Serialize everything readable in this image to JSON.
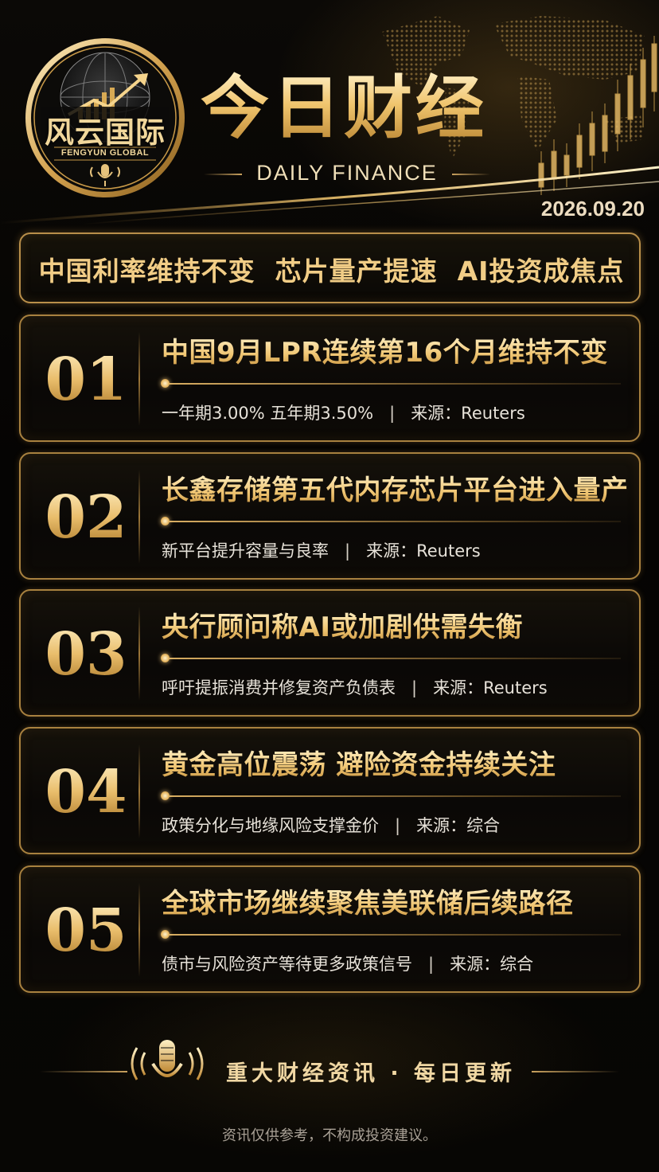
{
  "brand": {
    "logo_name": "风云国际",
    "logo_subtitle": "FENGYUN GLOBAL"
  },
  "header": {
    "title": "今日财经",
    "subtitle": "DAILY FINANCE",
    "date": "2026.09.20"
  },
  "headline": "中国利率维持不变  芯片量产提速  AI投资成焦点",
  "news": [
    {
      "num": "01",
      "title": "中国9月LPR连续第16个月维持不变",
      "detail": "一年期3.00% 五年期3.50%",
      "separator": "|",
      "source": "来源：Reuters"
    },
    {
      "num": "02",
      "title": "长鑫存储第五代内存芯片平台进入量产",
      "detail": "新平台提升容量与良率",
      "separator": "|",
      "source": "来源：Reuters"
    },
    {
      "num": "03",
      "title": "央行顾问称AI或加剧供需失衡",
      "detail": "呼吁提振消费并修复资产负债表",
      "separator": "|",
      "source": "来源：Reuters"
    },
    {
      "num": "04",
      "title": "黄金高位震荡  避险资金持续关注",
      "detail": "政策分化与地缘风险支撑金价",
      "separator": "|",
      "source": "来源：综合"
    },
    {
      "num": "05",
      "title": "全球市场继续聚焦美联储后续路径",
      "detail": "债市与风险资产等待更多政策信号",
      "separator": "|",
      "source": "来源：综合"
    }
  ],
  "footer": {
    "tagline": "重大财经资讯 · 每日更新",
    "disclaimer": "资讯仅供参考，不构成投资建议。"
  },
  "icons": {
    "logo": "globe-rising-arrow-icon",
    "mic": "microphone-icon"
  },
  "colors": {
    "gold": "#f0c673",
    "background": "#050403",
    "border": "#a8813f"
  }
}
